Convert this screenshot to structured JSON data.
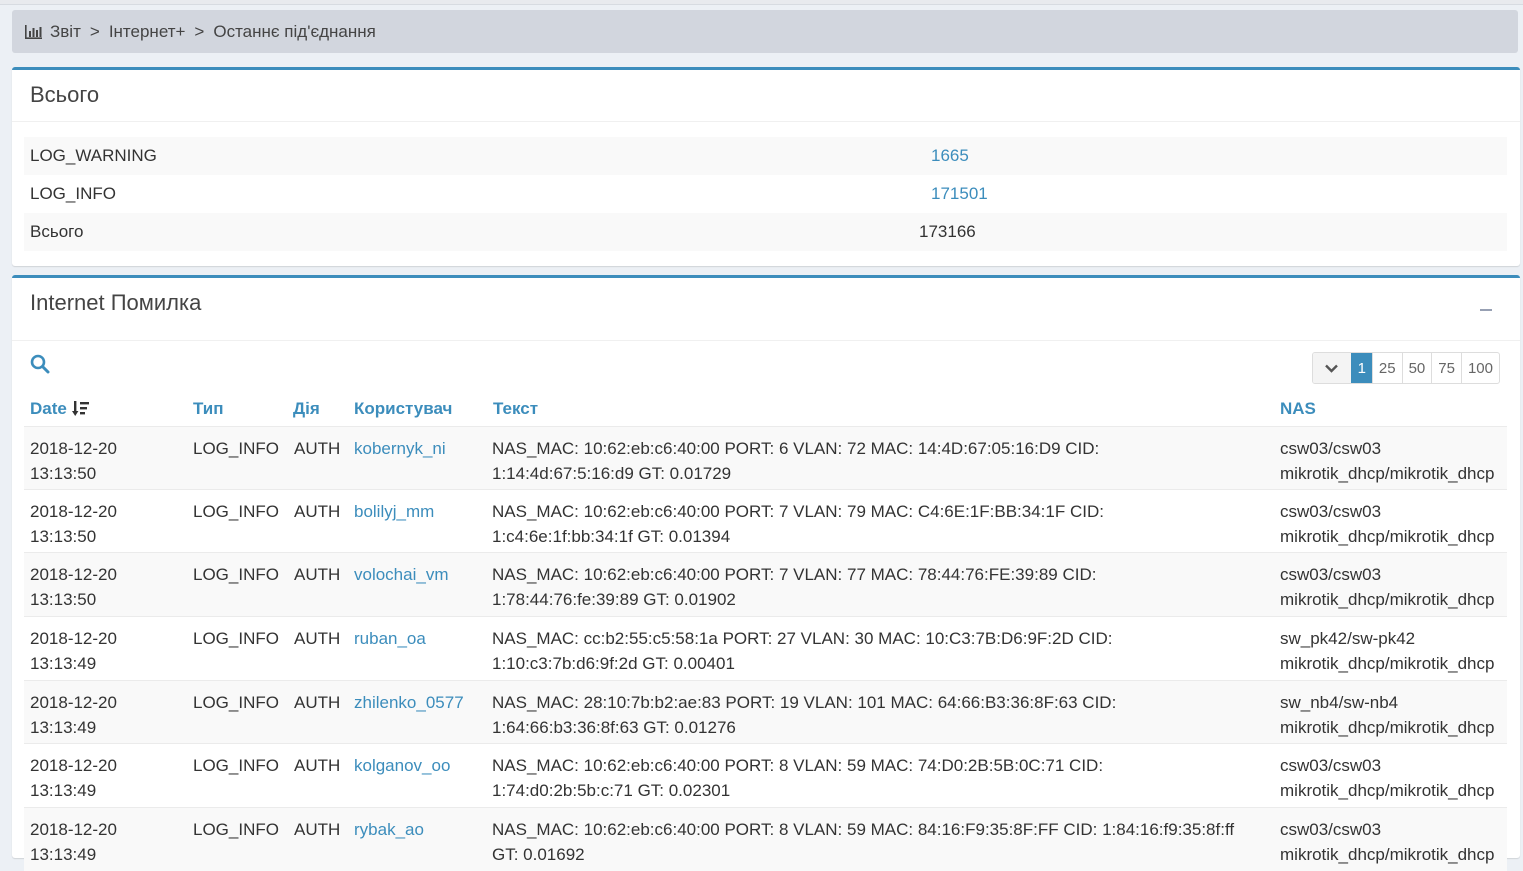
{
  "breadcrumb": {
    "items": [
      "Звіт",
      "Інтернет+",
      "Останнє під'єднання"
    ],
    "separator": ">"
  },
  "summary": {
    "title": "Всього",
    "rows": [
      {
        "label": "LOG_WARNING",
        "value": "1665"
      },
      {
        "label": "LOG_INFO",
        "value": "171501"
      },
      {
        "label": "Всього",
        "value": "173166"
      }
    ]
  },
  "errors": {
    "title": "Internet Помилка",
    "page_sizes": [
      "1",
      "25",
      "50",
      "75",
      "100"
    ],
    "active_page_size": "1",
    "columns": {
      "date": "Date",
      "type": "Тип",
      "action": "Дія",
      "user": "Користувач",
      "text": "Текст",
      "nas": "NAS"
    },
    "rows": [
      {
        "date": "2018-12-20",
        "time": "13:13:50",
        "type": "LOG_INFO",
        "action": "AUTH",
        "user": "kobernyk_ni",
        "text1": "NAS_MAC: 10:62:eb:c6:40:00 PORT: 6 VLAN: 72 MAC: 14:4D:67:05:16:D9 CID:",
        "text2": "1:14:4d:67:5:16:d9 GT: 0.01729",
        "nas1": "csw03/csw03",
        "nas2": "mikrotik_dhcp/mikrotik_dhcp"
      },
      {
        "date": "2018-12-20",
        "time": "13:13:50",
        "type": "LOG_INFO",
        "action": "AUTH",
        "user": "bolilyj_mm",
        "text1": "NAS_MAC: 10:62:eb:c6:40:00 PORT: 7 VLAN: 79 MAC: C4:6E:1F:BB:34:1F CID:",
        "text2": "1:c4:6e:1f:bb:34:1f GT: 0.01394",
        "nas1": "csw03/csw03",
        "nas2": "mikrotik_dhcp/mikrotik_dhcp"
      },
      {
        "date": "2018-12-20",
        "time": "13:13:50",
        "type": "LOG_INFO",
        "action": "AUTH",
        "user": "volochai_vm",
        "text1": "NAS_MAC: 10:62:eb:c6:40:00 PORT: 7 VLAN: 77 MAC: 78:44:76:FE:39:89 CID:",
        "text2": "1:78:44:76:fe:39:89 GT: 0.01902",
        "nas1": "csw03/csw03",
        "nas2": "mikrotik_dhcp/mikrotik_dhcp"
      },
      {
        "date": "2018-12-20",
        "time": "13:13:49",
        "type": "LOG_INFO",
        "action": "AUTH",
        "user": "ruban_oa",
        "text1": "NAS_MAC: cc:b2:55:c5:58:1a PORT: 27 VLAN: 30 MAC: 10:C3:7B:D6:9F:2D CID:",
        "text2": "1:10:c3:7b:d6:9f:2d GT: 0.00401",
        "nas1": "sw_pk42/sw-pk42",
        "nas2": "mikrotik_dhcp/mikrotik_dhcp"
      },
      {
        "date": "2018-12-20",
        "time": "13:13:49",
        "type": "LOG_INFO",
        "action": "AUTH",
        "user": "zhilenko_0577",
        "text1": "NAS_MAC: 28:10:7b:b2:ae:83 PORT: 19 VLAN: 101 MAC: 64:66:B3:36:8F:63 CID:",
        "text2": "1:64:66:b3:36:8f:63 GT: 0.01276",
        "nas1": "sw_nb4/sw-nb4",
        "nas2": "mikrotik_dhcp/mikrotik_dhcp"
      },
      {
        "date": "2018-12-20",
        "time": "13:13:49",
        "type": "LOG_INFO",
        "action": "AUTH",
        "user": "kolganov_oo",
        "text1": "NAS_MAC: 10:62:eb:c6:40:00 PORT: 8 VLAN: 59 MAC: 74:D0:2B:5B:0C:71 CID:",
        "text2": "1:74:d0:2b:5b:c:71 GT: 0.02301",
        "nas1": "csw03/csw03",
        "nas2": "mikrotik_dhcp/mikrotik_dhcp"
      },
      {
        "date": "2018-12-20",
        "time": "13:13:49",
        "type": "LOG_INFO",
        "action": "AUTH",
        "user": "rybak_ao",
        "text1": "NAS_MAC: 10:62:eb:c6:40:00 PORT: 8 VLAN: 59 MAC: 84:16:F9:35:8F:FF CID: 1:84:16:f9:35:8f:ff",
        "text2": "GT: 0.01692",
        "nas1": "csw03/csw03",
        "nas2": "mikrotik_dhcp/mikrotik_dhcp"
      }
    ]
  },
  "colors": {
    "accent": "#3c8dbc",
    "breadcrumb_bg": "#d2d6de"
  }
}
